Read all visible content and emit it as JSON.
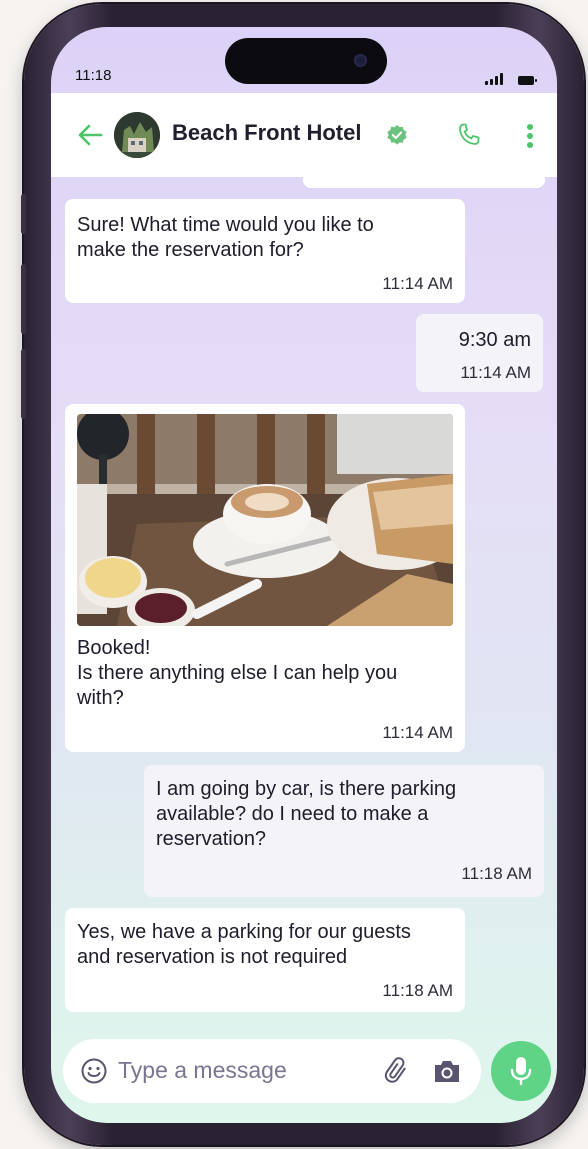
{
  "status_bar": {
    "time": "11:18"
  },
  "header": {
    "title": "Beach Front Hotel",
    "accent_color": "#4cc46a",
    "icons": [
      "back-arrow-icon",
      "verified-badge-icon",
      "phone-icon",
      "more-vert-icon"
    ]
  },
  "messages": [
    {
      "side": "left",
      "text": "Sure! What time would you like to\nmake the reservation for?",
      "time": "11:14 AM"
    },
    {
      "side": "right",
      "text": "9:30 am",
      "time": "11:14 AM"
    },
    {
      "side": "left",
      "image": "coffee-and-toast-photo",
      "text": "Booked!\nIs there anything else I can help you\nwith?",
      "time": "11:14 AM"
    },
    {
      "side": "right",
      "text": "I am going by car, is there parking\navailable? do I need to make a\nreservation?",
      "time": "11:18 AM"
    },
    {
      "side": "left",
      "text": "Yes, we have a parking for our guests\nand reservation is not required",
      "time": "11:18 AM"
    }
  ],
  "composer": {
    "placeholder": "Type a message",
    "icons": [
      "emoji-icon",
      "paperclip-icon",
      "camera-icon",
      "microphone-icon"
    ],
    "mic_color": "#5fd486"
  }
}
